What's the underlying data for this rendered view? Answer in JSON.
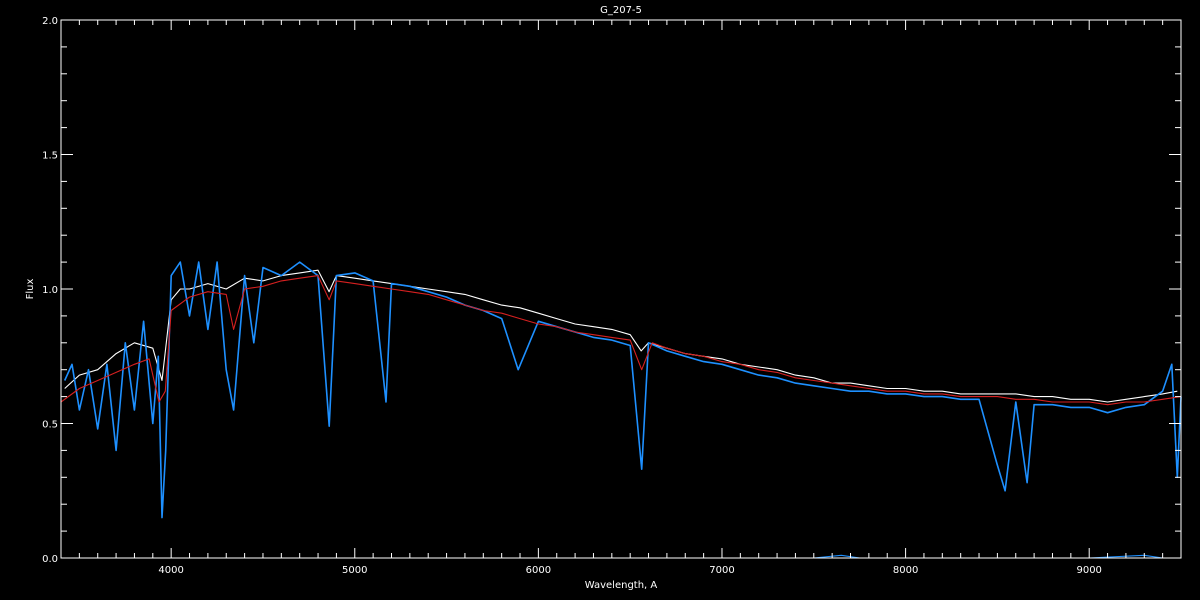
{
  "chart_data": {
    "type": "line",
    "title": "G_207-5",
    "xlabel": "Wavelength, A",
    "ylabel": "Flux",
    "xlim": [
      3400,
      9500
    ],
    "ylim": [
      0.0,
      2.0
    ],
    "x_ticks": [
      4000,
      5000,
      6000,
      7000,
      8000,
      9000
    ],
    "x_tick_labels": [
      "4000",
      "5000",
      "6000",
      "7000",
      "8000",
      "9000"
    ],
    "y_ticks": [
      0.0,
      0.5,
      1.0,
      1.5,
      2.0
    ],
    "y_tick_labels": [
      "0.0",
      "0.5",
      "1.0",
      "1.5",
      "2.0"
    ],
    "grid": false,
    "legend": "none",
    "background": "#000000",
    "axis_color": "#ffffff",
    "series": [
      {
        "color": "#ffffff",
        "x": [
          3420,
          3500,
          3600,
          3700,
          3800,
          3900,
          3950,
          4000,
          4050,
          4100,
          4200,
          4300,
          4400,
          4500,
          4600,
          4700,
          4800,
          4860,
          4900,
          5000,
          5100,
          5200,
          5300,
          5400,
          5500,
          5600,
          5700,
          5800,
          5900,
          6000,
          6100,
          6200,
          6300,
          6400,
          6500,
          6560,
          6600,
          6700,
          6800,
          6900,
          7000,
          7100,
          7200,
          7300,
          7400,
          7500,
          7600,
          7700,
          7800,
          7900,
          8000,
          8100,
          8200,
          8300,
          8400,
          8500,
          8600,
          8700,
          8800,
          8900,
          9000,
          9100,
          9200,
          9300,
          9400,
          9480
        ],
        "y": [
          0.63,
          0.68,
          0.7,
          0.76,
          0.8,
          0.78,
          0.66,
          0.96,
          1.0,
          1.0,
          1.02,
          1.0,
          1.04,
          1.03,
          1.05,
          1.06,
          1.07,
          0.99,
          1.05,
          1.04,
          1.03,
          1.02,
          1.01,
          1.0,
          0.99,
          0.98,
          0.96,
          0.94,
          0.93,
          0.91,
          0.89,
          0.87,
          0.86,
          0.85,
          0.83,
          0.77,
          0.8,
          0.78,
          0.76,
          0.75,
          0.74,
          0.72,
          0.71,
          0.7,
          0.68,
          0.67,
          0.65,
          0.65,
          0.64,
          0.63,
          0.63,
          0.62,
          0.62,
          0.61,
          0.61,
          0.61,
          0.61,
          0.6,
          0.6,
          0.59,
          0.59,
          0.58,
          0.59,
          0.6,
          0.61,
          0.62
        ]
      },
      {
        "color": "#1e90ff",
        "x": [
          3420,
          3460,
          3500,
          3550,
          3600,
          3650,
          3700,
          3750,
          3800,
          3850,
          3900,
          3930,
          3950,
          3970,
          4000,
          4050,
          4100,
          4150,
          4200,
          4250,
          4300,
          4340,
          4400,
          4450,
          4500,
          4600,
          4700,
          4800,
          4861,
          4900,
          5000,
          5100,
          5170,
          5200,
          5300,
          5400,
          5500,
          5600,
          5700,
          5800,
          5890,
          6000,
          6100,
          6200,
          6300,
          6400,
          6500,
          6563,
          6600,
          6700,
          6800,
          6900,
          7000,
          7100,
          7200,
          7300,
          7400,
          7500,
          7600,
          7700,
          7800,
          7900,
          8000,
          8100,
          8200,
          8300,
          8400,
          8498,
          8542,
          8600,
          8662,
          8700,
          8800,
          8900,
          9000,
          9100,
          9200,
          9300,
          9400,
          9450,
          9480,
          9500
        ],
        "y": [
          0.66,
          0.72,
          0.55,
          0.7,
          0.48,
          0.72,
          0.4,
          0.8,
          0.55,
          0.88,
          0.5,
          0.75,
          0.15,
          0.4,
          1.05,
          1.1,
          0.9,
          1.1,
          0.85,
          1.1,
          0.7,
          0.55,
          1.05,
          0.8,
          1.08,
          1.05,
          1.1,
          1.05,
          0.49,
          1.05,
          1.06,
          1.03,
          0.58,
          1.02,
          1.01,
          0.99,
          0.97,
          0.94,
          0.92,
          0.89,
          0.7,
          0.88,
          0.86,
          0.84,
          0.82,
          0.81,
          0.79,
          0.33,
          0.8,
          0.77,
          0.75,
          0.73,
          0.72,
          0.7,
          0.68,
          0.67,
          0.65,
          0.64,
          0.63,
          0.62,
          0.62,
          0.61,
          0.61,
          0.6,
          0.6,
          0.59,
          0.59,
          0.35,
          0.25,
          0.58,
          0.28,
          0.57,
          0.57,
          0.56,
          0.56,
          0.54,
          0.56,
          0.57,
          0.62,
          0.72,
          0.3,
          0.6
        ]
      },
      {
        "color": "#d62020",
        "x": [
          3400,
          3500,
          3600,
          3700,
          3800,
          3880,
          3934,
          3968,
          4000,
          4100,
          4200,
          4300,
          4340,
          4400,
          4500,
          4600,
          4700,
          4800,
          4861,
          4900,
          5000,
          5100,
          5200,
          5300,
          5400,
          5500,
          5600,
          5700,
          5800,
          5900,
          6000,
          6100,
          6200,
          6300,
          6400,
          6500,
          6563,
          6620,
          6700,
          6800,
          6900,
          7000,
          7100,
          7200,
          7300,
          7400,
          7500,
          7600,
          7700,
          7800,
          7900,
          8000,
          8100,
          8200,
          8300,
          8400,
          8500,
          8600,
          8700,
          8800,
          8900,
          9000,
          9100,
          9200,
          9300,
          9400,
          9500
        ],
        "y": [
          0.58,
          0.63,
          0.66,
          0.69,
          0.72,
          0.74,
          0.58,
          0.62,
          0.92,
          0.97,
          0.99,
          0.98,
          0.85,
          1.0,
          1.01,
          1.03,
          1.04,
          1.05,
          0.96,
          1.03,
          1.02,
          1.01,
          1.0,
          0.99,
          0.98,
          0.96,
          0.94,
          0.92,
          0.91,
          0.89,
          0.87,
          0.86,
          0.84,
          0.83,
          0.82,
          0.81,
          0.7,
          0.8,
          0.78,
          0.76,
          0.75,
          0.73,
          0.72,
          0.7,
          0.69,
          0.67,
          0.66,
          0.65,
          0.64,
          0.63,
          0.62,
          0.62,
          0.61,
          0.61,
          0.6,
          0.6,
          0.6,
          0.59,
          0.59,
          0.58,
          0.58,
          0.58,
          0.57,
          0.58,
          0.58,
          0.59,
          0.6
        ]
      },
      {
        "color": "#1e90ff",
        "x": [
          3400,
          5000,
          7500,
          7650,
          7750,
          8000,
          9000,
          9300,
          9400,
          9500
        ],
        "y": [
          0.0,
          0.0,
          0.0,
          0.01,
          0.0,
          0.0,
          0.0,
          0.01,
          0.0,
          0.0
        ]
      }
    ]
  }
}
